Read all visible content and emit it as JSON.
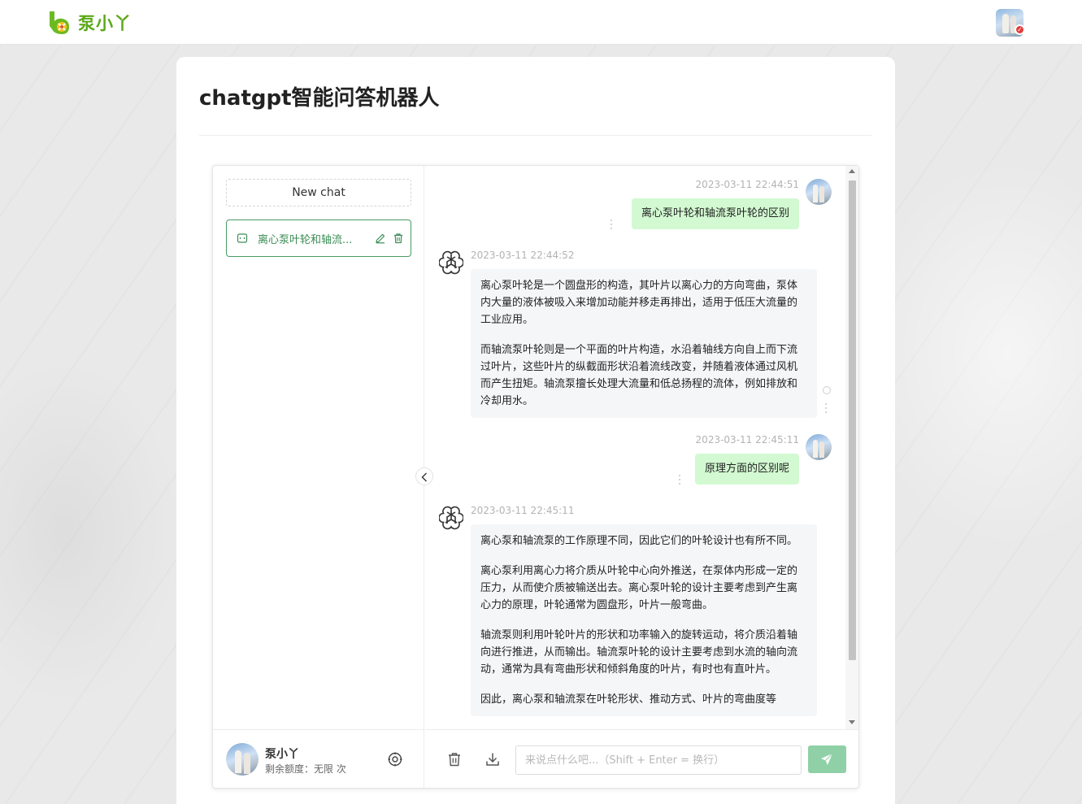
{
  "brand": {
    "name": "泵小丫",
    "accent": "#5ba818"
  },
  "page": {
    "title": "chatgpt智能问答机器人"
  },
  "sidebar": {
    "new_chat_label": "New chat",
    "active_chat": {
      "label": "离心泵叶轮和轴流...",
      "accent": "#3b8d55"
    },
    "user": {
      "name": "泵小丫",
      "quota": "剩余额度：无限 次"
    }
  },
  "messages": [
    {
      "role": "user",
      "time": "2023-03-11 22:44:51",
      "text": "离心泵叶轮和轴流泵叶轮的区别"
    },
    {
      "role": "assistant",
      "time": "2023-03-11 22:44:52",
      "paragraphs": [
        "离心泵叶轮是一个圆盘形的构造，其叶片以离心力的方向弯曲，泵体内大量的液体被吸入来增加动能并移走再排出，适用于低压大流量的工业应用。",
        "而轴流泵叶轮则是一个平面的叶片构造，水沿着轴线方向自上而下流过叶片，这些叶片的纵截面形状沿着流线改变，并随着液体通过风机而产生扭矩。轴流泵擅长处理大流量和低总扬程的流体，例如排放和冷却用水。"
      ]
    },
    {
      "role": "user",
      "time": "2023-03-11 22:45:11",
      "text": "原理方面的区别呢"
    },
    {
      "role": "assistant",
      "time": "2023-03-11 22:45:11",
      "paragraphs": [
        "离心泵和轴流泵的工作原理不同，因此它们的叶轮设计也有所不同。",
        "离心泵利用离心力将介质从叶轮中心向外推送，在泵体内形成一定的压力，从而使介质被输送出去。离心泵叶轮的设计主要考虑到产生离心力的原理，叶轮通常为圆盘形，叶片一般弯曲。",
        "轴流泵则利用叶轮叶片的形状和功率输入的旋转运动，将介质沿着轴向进行推进，从而输出。轴流泵叶轮的设计主要考虑到水流的轴向流动，通常为具有弯曲形状和倾斜角度的叶片，有时也有直叶片。",
        "因此，离心泵和轴流泵在叶轮形状、推动方式、叶片的弯曲度等"
      ]
    }
  ],
  "composer": {
    "placeholder": "来说点什么吧...（Shift + Enter = 换行）",
    "send_color": "#8fd0a7"
  },
  "icons": {
    "clear": "trash-icon",
    "export": "download-icon",
    "send": "paper-plane-icon",
    "settings": "settings-icon",
    "bot": "openai-logo-icon"
  }
}
